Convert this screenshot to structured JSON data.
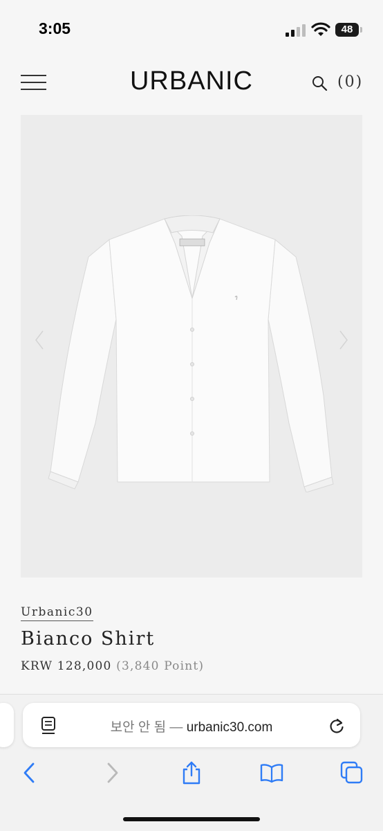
{
  "status_bar": {
    "time": "3:05",
    "battery": "48"
  },
  "header": {
    "logo": "URBANIC",
    "cart_count": "(0)"
  },
  "product": {
    "brand": "Urbanic30",
    "name": "Bianco Shirt",
    "price": "KRW 128,000",
    "points": "(3,840 Point)"
  },
  "browser": {
    "security_note": "보안 안 됨",
    "separator": "—",
    "domain": "urbanic30.com"
  },
  "icons": {
    "menu": "hamburger-icon",
    "search": "search-icon",
    "prev_image": "chevron-left-icon",
    "next_image": "chevron-right-icon",
    "page_menu": "page-format-icon",
    "reload": "reload-icon",
    "back": "back-icon",
    "forward": "forward-icon",
    "share": "share-icon",
    "bookmarks": "bookmarks-icon",
    "tabs": "tabs-icon"
  },
  "colors": {
    "accent_blue": "#2f7cf6",
    "image_bg": "#ececec"
  }
}
